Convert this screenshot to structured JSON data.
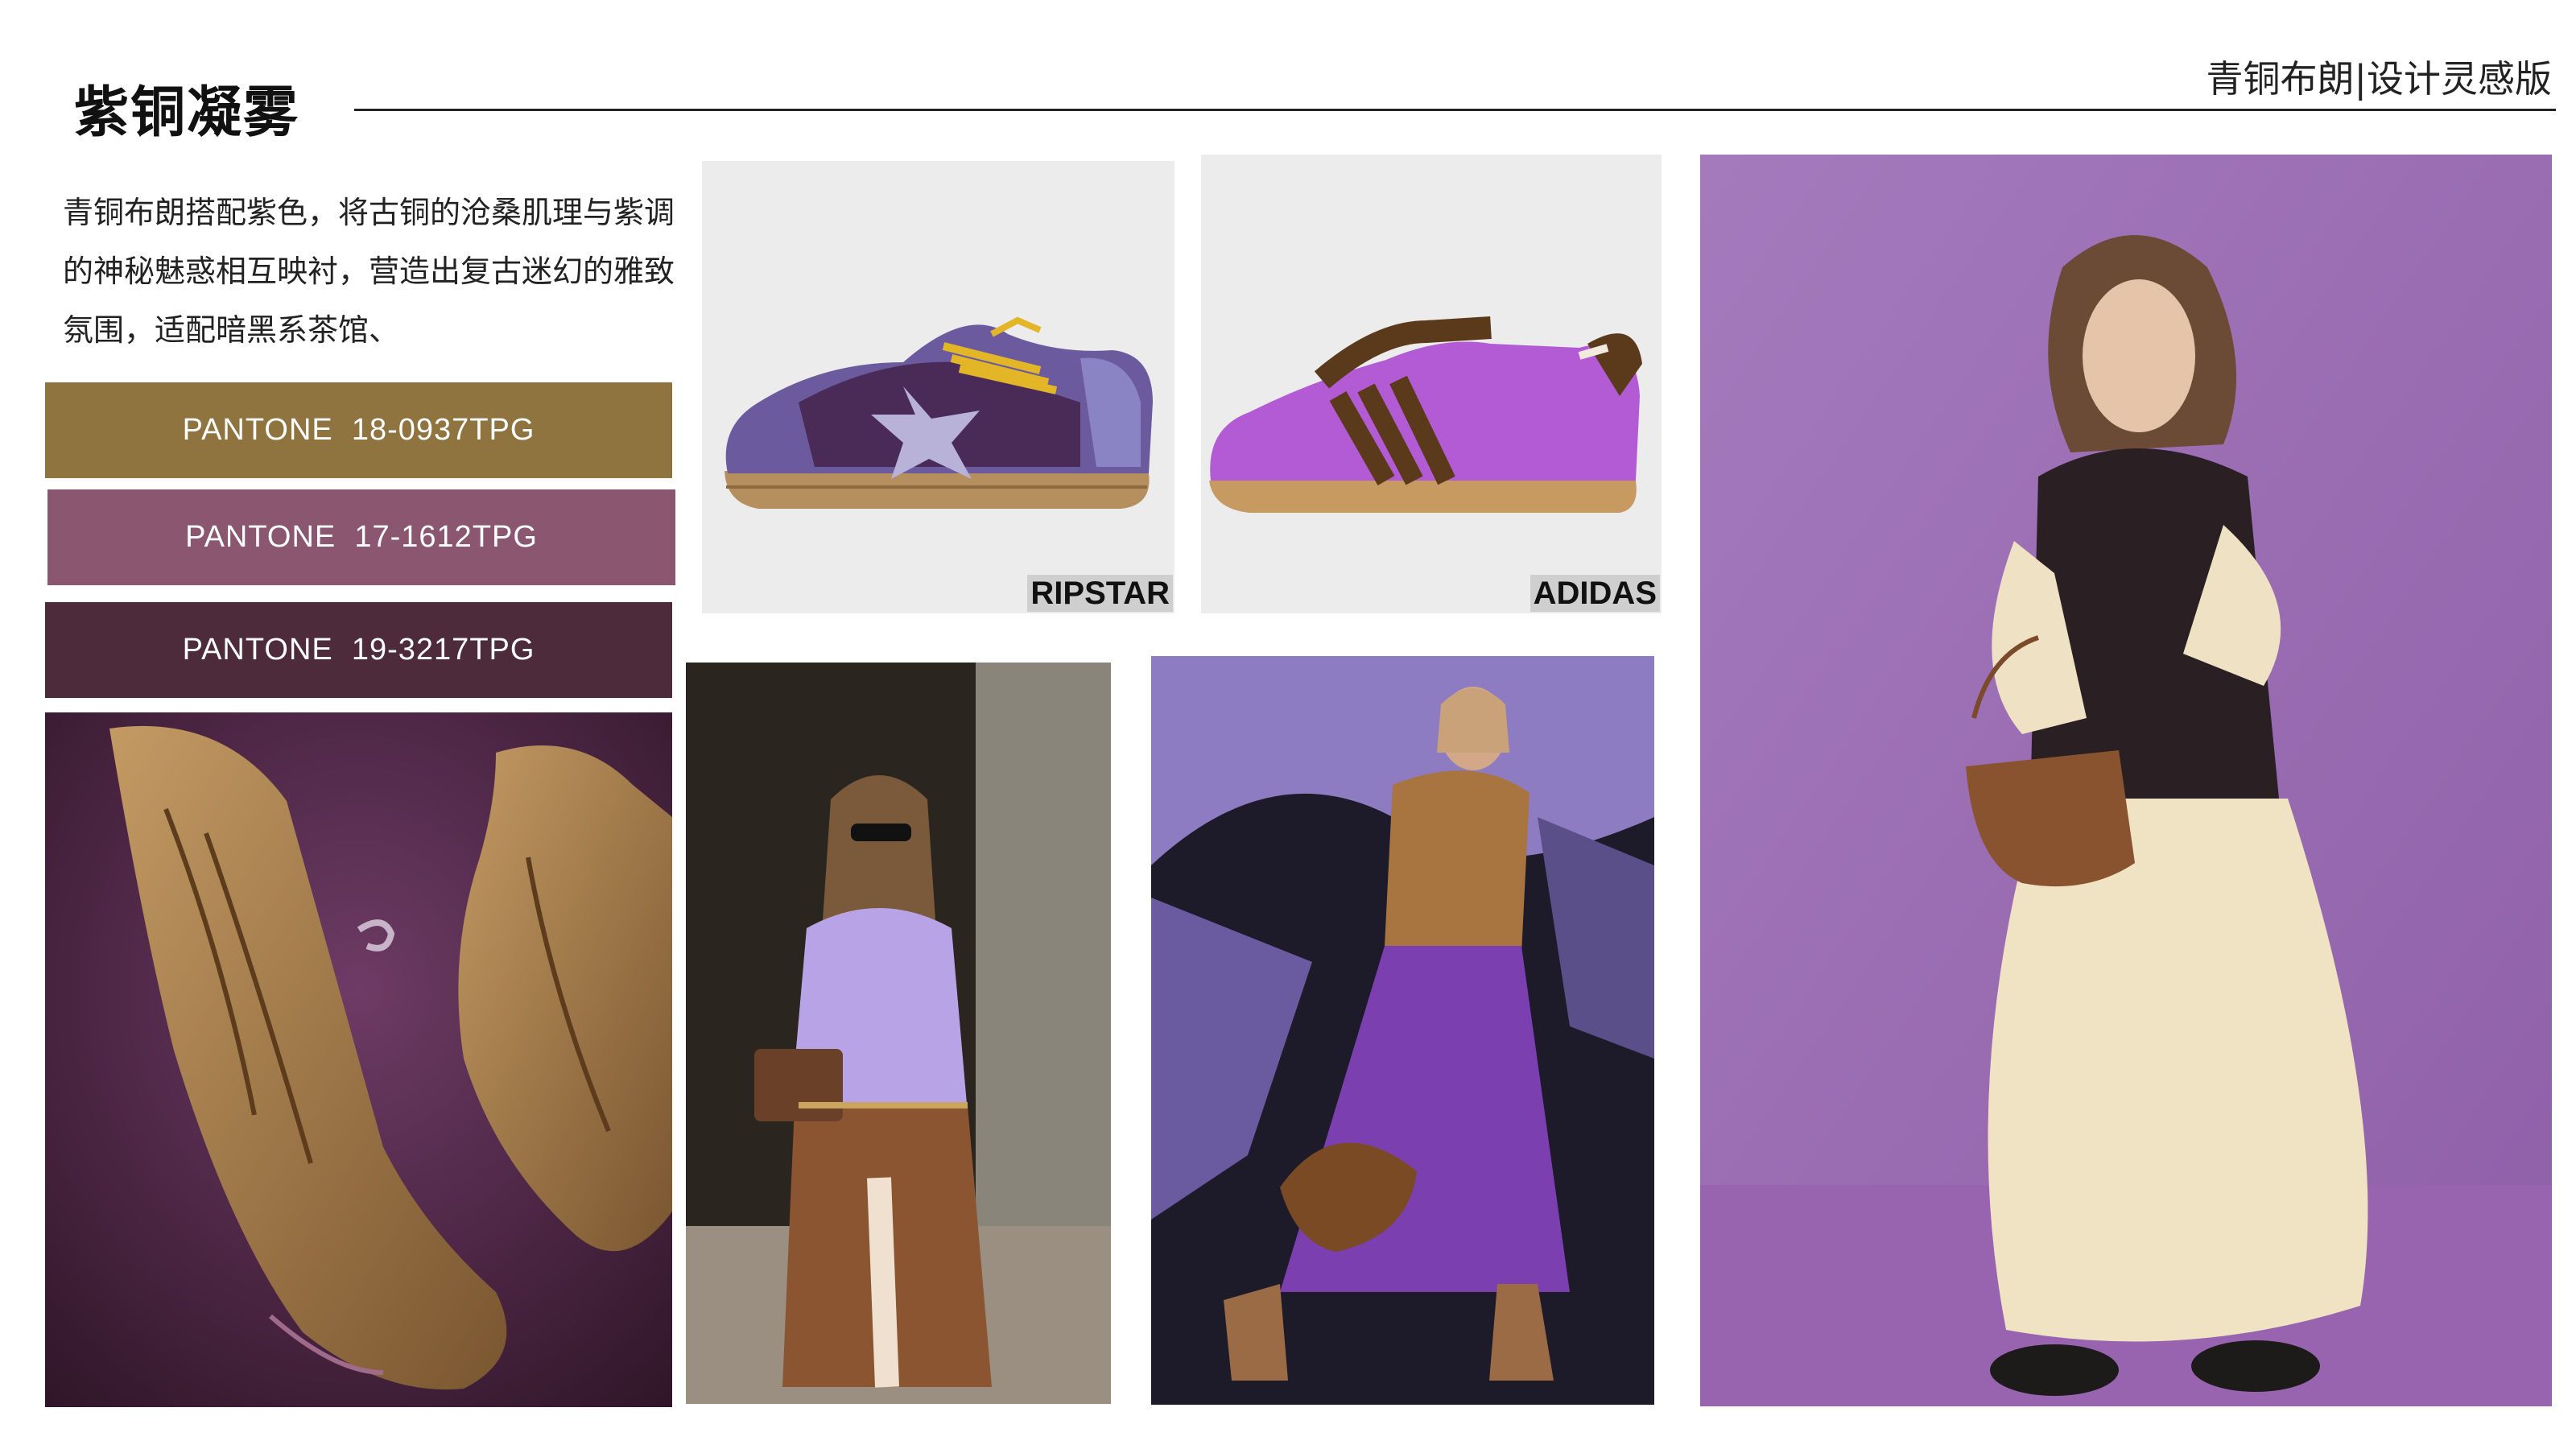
{
  "page": {
    "title": "紫铜凝雾",
    "header_right": "青铜布朗|设计灵感版",
    "description": "青铜布朗搭配紫色，将古铜的沧桑肌理与紫调的神秘魅惑相互映衬，营造出复古迷幻的雅致氛围，适配暗黑系茶馆、"
  },
  "swatches": [
    {
      "label": "PANTONE  18-0937TPG",
      "color": "#8f7440"
    },
    {
      "label": "PANTONE  17-1612TPG",
      "color": "#8a5670"
    },
    {
      "label": "PANTONE  19-3217TPG",
      "color": "#4d2b3b"
    }
  ],
  "sneakers": [
    {
      "brand": "RIPSTAR"
    },
    {
      "brand": "ADIDAS"
    }
  ],
  "photos": [
    {
      "subject": "bronze-lace-up-boots"
    },
    {
      "subject": "lavender-sweater-brown-skirt-look"
    },
    {
      "subject": "brown-blouse-purple-skirt-look"
    },
    {
      "subject": "leather-vest-cream-skirt-look"
    }
  ],
  "colors": {
    "background": "#ffffff",
    "rule": "#222222",
    "sneaker_panel": "#ececec",
    "purple_wall": "#9a6bb0"
  }
}
